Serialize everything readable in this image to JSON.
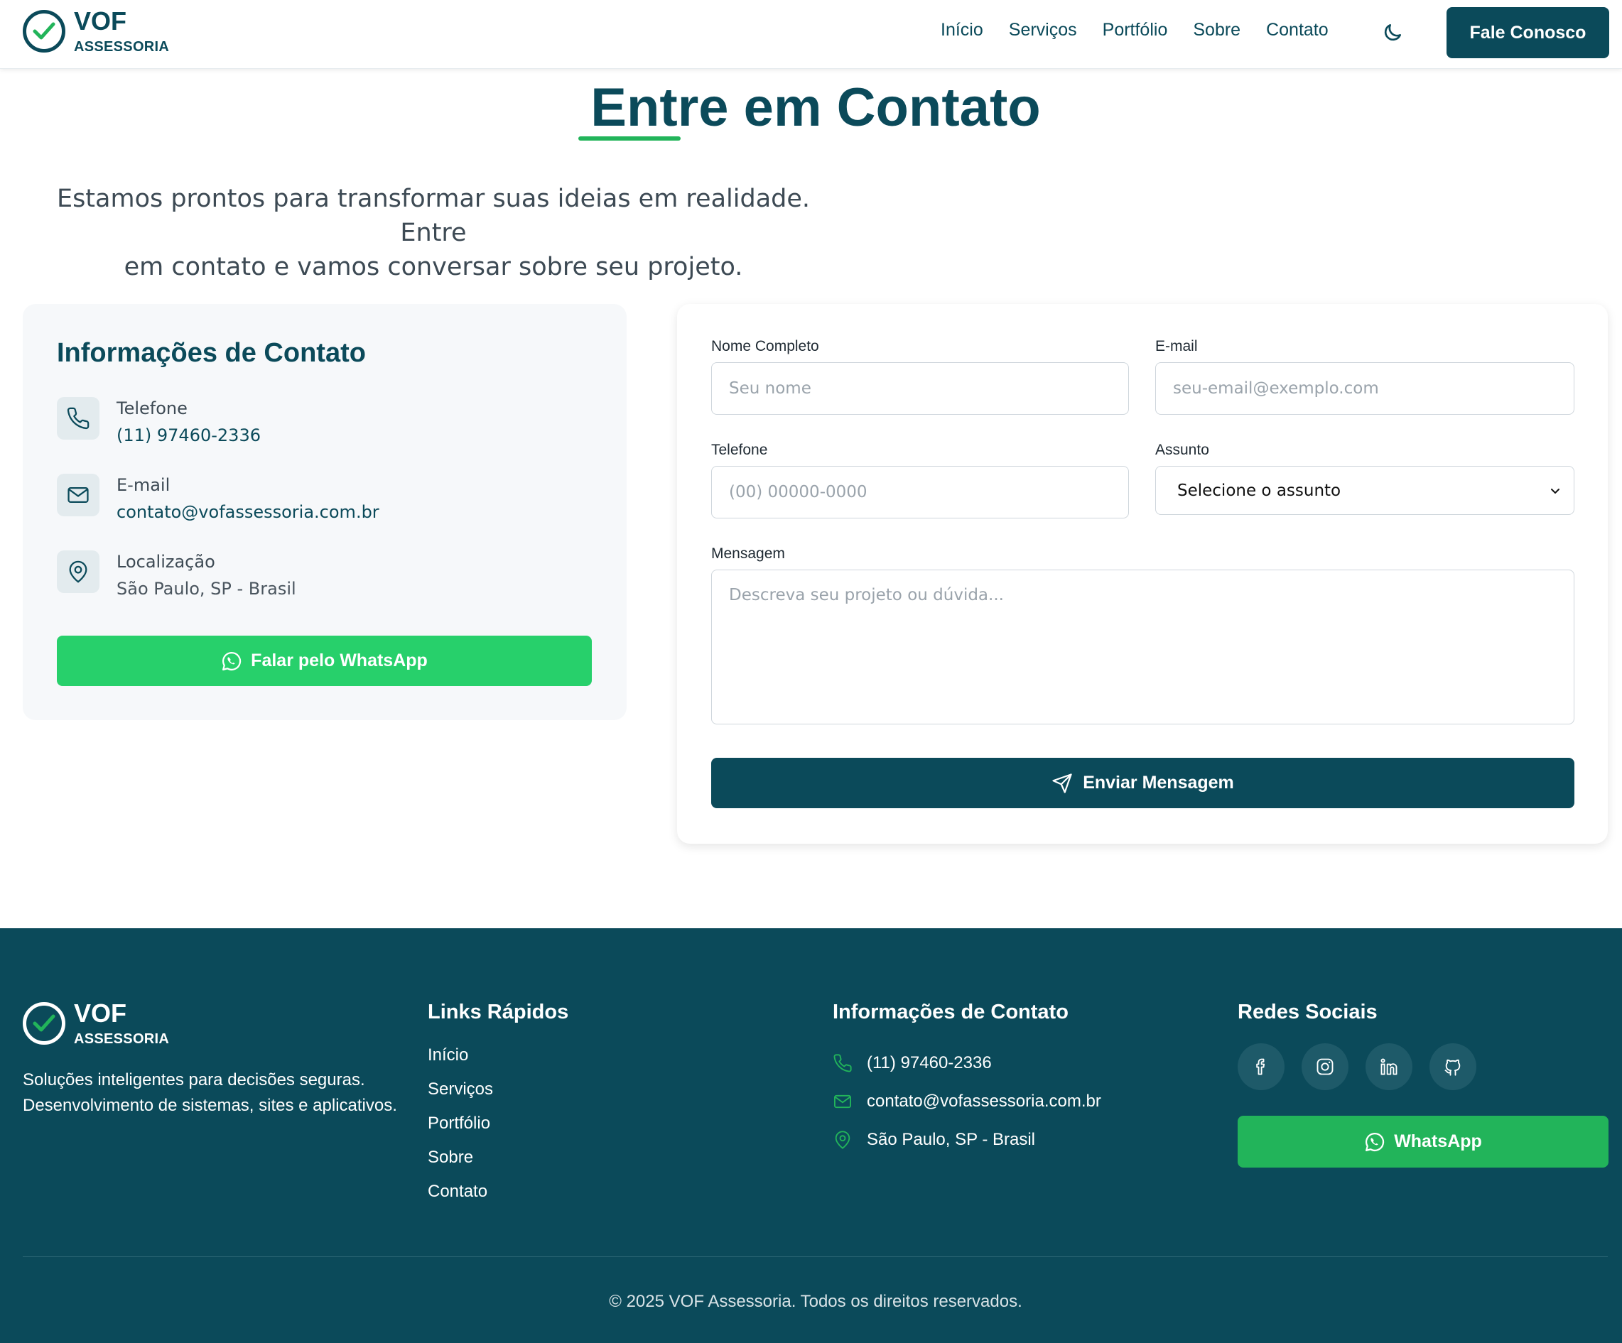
{
  "brand": {
    "name": "VOF",
    "subtitle": "ASSESSORIA"
  },
  "nav": {
    "items": [
      "Início",
      "Serviços",
      "Portfólio",
      "Sobre",
      "Contato"
    ],
    "theme_toggle_icon": "moon-icon",
    "cta_label": "Fale Conosco"
  },
  "hero": {
    "title": "Entre em Contato",
    "subtitle_line1": "Estamos prontos para transformar suas ideias em realidade. Entre",
    "subtitle_line2": "em contato e vamos conversar sobre seu projeto."
  },
  "info": {
    "title": "Informações de Contato",
    "items": [
      {
        "label": "Telefone",
        "value": "(11) 97460-2336",
        "icon": "phone-icon"
      },
      {
        "label": "E-mail",
        "value": "contato@vofassessoria.com.br",
        "icon": "mail-icon"
      },
      {
        "label": "Localização",
        "value": "São Paulo, SP - Brasil",
        "icon": "map-pin-icon"
      }
    ],
    "whatsapp_label": "Falar pelo WhatsApp"
  },
  "form": {
    "name_label": "Nome Completo",
    "name_placeholder": "Seu nome",
    "email_label": "E-mail",
    "email_placeholder": "seu-email@exemplo.com",
    "phone_label": "Telefone",
    "phone_placeholder": "(00) 00000-0000",
    "subject_label": "Assunto",
    "subject_selected": "Selecione o assunto",
    "message_label": "Mensagem",
    "message_placeholder": "Descreva seu projeto ou dúvida...",
    "submit_label": "Enviar Mensagem"
  },
  "footer": {
    "description": "Soluções inteligentes para decisões seguras. Desenvolvimento de sistemas, sites e aplicativos.",
    "links_title": "Links Rápidos",
    "links": [
      "Início",
      "Serviços",
      "Portfólio",
      "Sobre",
      "Contato"
    ],
    "contact_title": "Informações de Contato",
    "contact": [
      "(11) 97460-2336",
      "contato@vofassessoria.com.br",
      "São Paulo, SP - Brasil"
    ],
    "social_title": "Redes Sociais",
    "socials": [
      "facebook-icon",
      "instagram-icon",
      "linkedin-icon",
      "github-icon"
    ],
    "whatsapp_label": "WhatsApp",
    "copyright": "© 2025 VOF Assessoria. Todos os direitos reservados."
  },
  "colors": {
    "primary": "#0b4a5a",
    "accent": "#22b45a",
    "whatsapp": "#27d06b"
  }
}
